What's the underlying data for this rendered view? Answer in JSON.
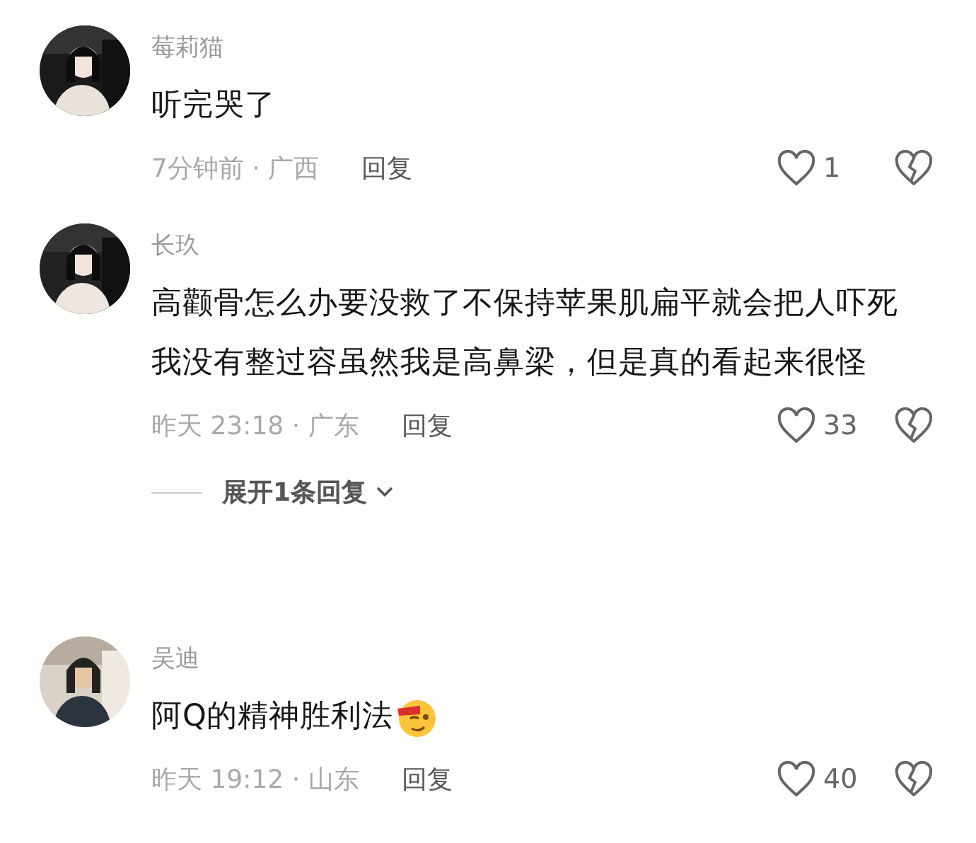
{
  "comments": [
    {
      "author": "莓莉猫",
      "text": "听完哭了",
      "has_emoji": false,
      "meta": "7分钟前 · 广西",
      "reply_label": "回复",
      "likes": "1",
      "liked": false
    },
    {
      "author": "长玖",
      "text": "高颧骨怎么办要没救了不保持苹果肌扁平就会把人吓死我没有整过容虽然我是高鼻梁，但是真的看起来很怪",
      "has_emoji": false,
      "meta": "昨天 23:18 · 广东",
      "reply_label": "回复",
      "likes": "33",
      "liked": false,
      "expand": "展开1条回复"
    },
    {
      "author": "吴迪",
      "text": "阿Q的精神胜利法",
      "has_emoji": true,
      "meta": "昨天 19:12 · 山东",
      "reply_label": "回复",
      "likes": "40",
      "liked": false
    }
  ]
}
